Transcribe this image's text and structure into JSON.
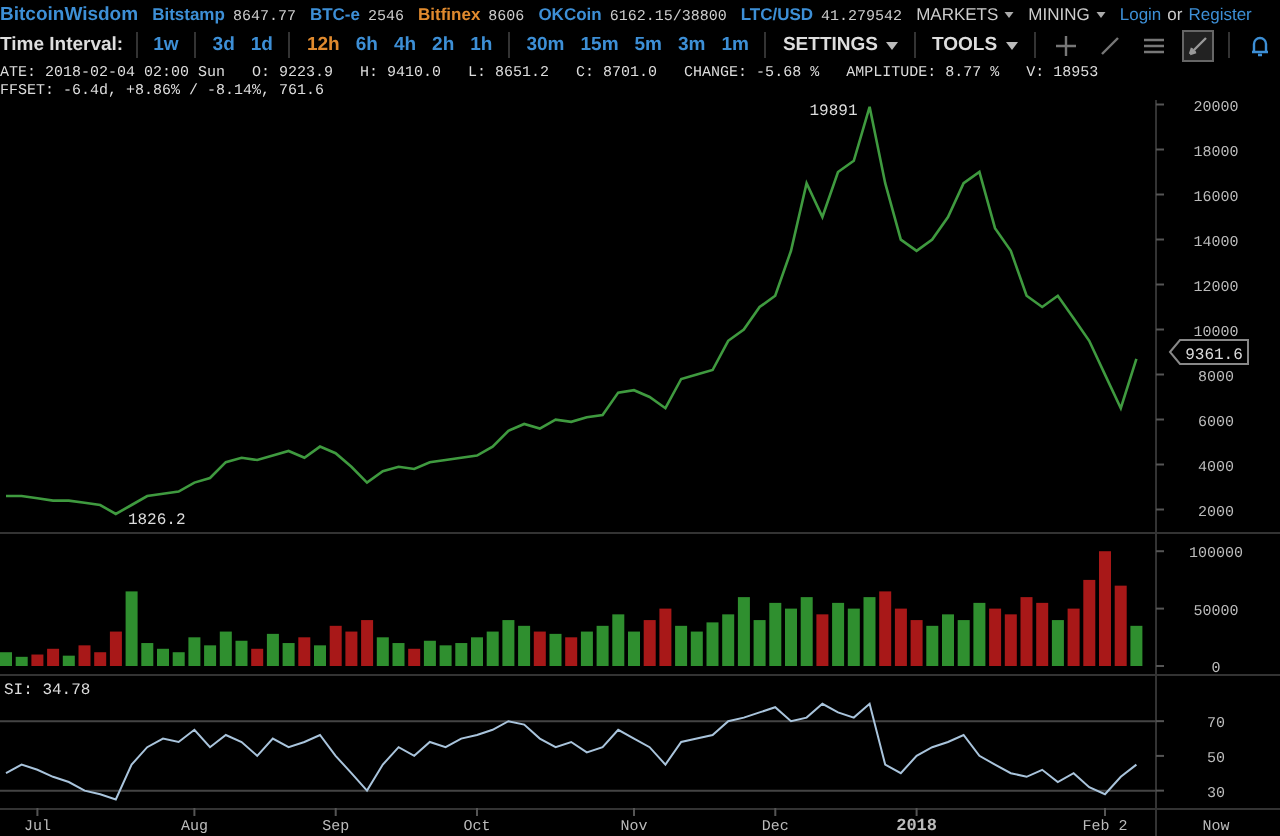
{
  "top_bar": {
    "logo": "BitcoinWisdom",
    "tickers": [
      {
        "name": "Bitstamp",
        "price": "8647.77",
        "color": "#3d8fd6"
      },
      {
        "name": "BTC-e",
        "price": "2546",
        "color": "#3d8fd6"
      },
      {
        "name": "Bitfinex",
        "price": "8606",
        "color": "#e08a2e"
      },
      {
        "name": "OKCoin",
        "price": "6162.15/38800",
        "color": "#3d8fd6"
      },
      {
        "name": "LTC/USD",
        "price": "41.279542",
        "color": "#3d8fd6"
      }
    ],
    "menus": [
      "MARKETS",
      "MINING"
    ],
    "login": "Login",
    "or": "or",
    "register": "Register"
  },
  "toolbar": {
    "label": "Time Interval:",
    "interval_groups": [
      [
        {
          "label": "1w",
          "selected": false
        }
      ],
      [
        {
          "label": "3d",
          "selected": false
        },
        {
          "label": "1d",
          "selected": false
        }
      ],
      [
        {
          "label": "12h",
          "selected": true
        },
        {
          "label": "6h",
          "selected": false
        },
        {
          "label": "4h",
          "selected": false
        },
        {
          "label": "2h",
          "selected": false
        },
        {
          "label": "1h",
          "selected": false
        }
      ],
      [
        {
          "label": "30m",
          "selected": false
        },
        {
          "label": "15m",
          "selected": false
        },
        {
          "label": "5m",
          "selected": false
        },
        {
          "label": "3m",
          "selected": false
        },
        {
          "label": "1m",
          "selected": false
        }
      ]
    ],
    "menus": [
      "SETTINGS",
      "TOOLS"
    ],
    "tools": [
      {
        "kind": "crosshair",
        "selected": false
      },
      {
        "kind": "line",
        "selected": false
      },
      {
        "kind": "lines",
        "selected": false
      },
      {
        "kind": "draw",
        "selected": true
      },
      {
        "kind": "alert",
        "selected": false
      }
    ]
  },
  "info_lines": [
    "ATE: 2018-02-04 02:00 Sun   O: 9223.9   H: 9410.0   L: 8651.2   C: 8701.0   CHANGE: -5.68 %   AMPLITUDE: 8.77 %   V: 18953",
    "FFSET: -6.4d, +8.86% / -8.14%, 761.6"
  ],
  "price_panel": {
    "chart_data": {
      "type": "line",
      "categories": [
        null,
        null,
        null,
        null,
        null,
        null,
        null,
        null,
        null,
        null,
        null,
        null,
        null,
        null,
        null,
        null,
        null,
        null,
        null,
        null,
        null,
        null,
        null,
        null,
        null,
        null,
        null,
        null,
        null,
        null,
        null,
        null,
        null,
        null,
        null,
        null,
        null,
        null,
        null,
        null,
        null,
        null,
        null,
        null,
        null,
        null,
        null,
        null,
        null,
        null,
        null,
        null,
        null,
        null,
        null,
        null,
        null,
        null,
        null,
        null,
        null,
        null,
        null,
        null,
        null,
        null,
        null,
        null,
        null,
        null,
        null,
        null,
        null
      ],
      "values": [
        2600,
        2600,
        2500,
        2400,
        2400,
        2300,
        2200,
        1800,
        2200,
        2600,
        2700,
        2800,
        3200,
        3400,
        4100,
        4300,
        4200,
        4400,
        4600,
        4300,
        4800,
        4500,
        3900,
        3200,
        3700,
        3900,
        3800,
        4100,
        4200,
        4300,
        4400,
        4800,
        5500,
        5800,
        5600,
        6000,
        5900,
        6100,
        6200,
        7200,
        7300,
        7000,
        6500,
        7800,
        8000,
        8200,
        9500,
        10000,
        11000,
        11500,
        13500,
        16500,
        15000,
        17000,
        17500,
        19900,
        16500,
        14000,
        13500,
        14000,
        15000,
        16500,
        17000,
        14500,
        13500,
        11500,
        11000,
        11500,
        10500,
        9500,
        8000,
        6500,
        8700
      ],
      "ylim": [
        1000,
        20200
      ],
      "yticks": [
        2000,
        4000,
        6000,
        8000,
        10000,
        12000,
        14000,
        16000,
        18000,
        20000
      ],
      "annotations": [
        "19891",
        "1826.2",
        "9361.6"
      ]
    }
  },
  "volume_panel": {
    "chart_data": {
      "type": "bar",
      "categories": [
        null,
        null,
        null,
        null,
        null,
        null,
        null,
        null,
        null,
        null,
        null,
        null,
        null,
        null,
        null,
        null,
        null,
        null,
        null,
        null,
        null,
        null,
        null,
        null,
        null,
        null,
        null,
        null,
        null,
        null,
        null,
        null,
        null,
        null,
        null,
        null,
        null,
        null,
        null,
        null,
        null,
        null,
        null,
        null,
        null,
        null,
        null,
        null,
        null,
        null,
        null,
        null,
        null,
        null,
        null,
        null,
        null,
        null,
        null,
        null,
        null,
        null,
        null,
        null,
        null,
        null,
        null,
        null,
        null,
        null,
        null,
        null,
        null
      ],
      "values": [
        12000,
        8000,
        10000,
        15000,
        9000,
        18000,
        12000,
        30000,
        65000,
        20000,
        15000,
        12000,
        25000,
        18000,
        30000,
        22000,
        15000,
        28000,
        20000,
        25000,
        18000,
        35000,
        30000,
        40000,
        25000,
        20000,
        15000,
        22000,
        18000,
        20000,
        25000,
        30000,
        40000,
        35000,
        30000,
        28000,
        25000,
        30000,
        35000,
        45000,
        30000,
        40000,
        50000,
        35000,
        30000,
        38000,
        45000,
        60000,
        40000,
        55000,
        50000,
        60000,
        45000,
        55000,
        50000,
        60000,
        65000,
        50000,
        40000,
        35000,
        45000,
        40000,
        55000,
        50000,
        45000,
        60000,
        55000,
        40000,
        50000,
        75000,
        100000,
        70000,
        35000
      ],
      "ylim": [
        0,
        115000
      ],
      "yticks": [
        0,
        50000,
        100000
      ]
    }
  },
  "rsi_panel": {
    "label": "SI: 34.78",
    "now_label": "Now",
    "chart_data": {
      "type": "line",
      "categories": [
        null,
        null,
        "Jul",
        null,
        null,
        null,
        null,
        null,
        null,
        null,
        null,
        null,
        "Aug",
        null,
        null,
        null,
        null,
        null,
        null,
        null,
        null,
        "Sep",
        null,
        null,
        null,
        null,
        null,
        null,
        null,
        null,
        "Oct",
        null,
        null,
        null,
        null,
        null,
        null,
        null,
        null,
        null,
        "Nov",
        null,
        null,
        null,
        null,
        null,
        null,
        null,
        null,
        "Dec",
        null,
        null,
        null,
        null,
        null,
        null,
        null,
        null,
        "2018",
        null,
        null,
        null,
        null,
        null,
        null,
        null,
        null,
        null,
        null,
        null,
        "Feb 2",
        null,
        null
      ],
      "values": [
        40,
        45,
        42,
        38,
        35,
        30,
        28,
        25,
        45,
        55,
        60,
        58,
        65,
        55,
        62,
        58,
        50,
        60,
        55,
        58,
        62,
        50,
        40,
        30,
        45,
        55,
        50,
        58,
        55,
        60,
        62,
        65,
        70,
        68,
        60,
        55,
        58,
        52,
        55,
        65,
        60,
        55,
        45,
        58,
        60,
        62,
        70,
        72,
        75,
        78,
        70,
        72,
        80,
        75,
        72,
        80,
        45,
        40,
        50,
        55,
        58,
        62,
        50,
        45,
        40,
        38,
        42,
        35,
        40,
        32,
        28,
        38,
        45
      ],
      "ylim": [
        20,
        96
      ],
      "yticks": [
        30,
        50,
        70
      ]
    }
  }
}
